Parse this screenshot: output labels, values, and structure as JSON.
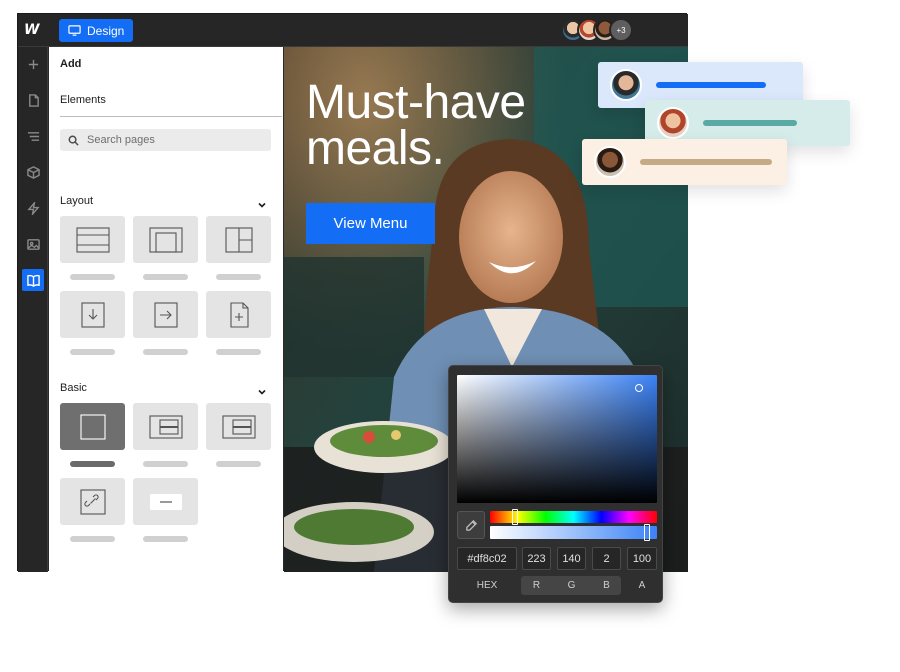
{
  "topbar": {
    "logo_text": "W",
    "design_button_label": "Design",
    "collaborators_extra": "+3"
  },
  "left_rail": {
    "icons": [
      "plus-icon",
      "page-icon",
      "navigator-icon",
      "components-icon",
      "interactions-icon",
      "assets-icon",
      "cms-book-icon"
    ],
    "active": "cms-book-icon"
  },
  "add_panel": {
    "title": "Add",
    "tab_label": "Elements",
    "search_placeholder": "Search pages",
    "sections": [
      {
        "label": "Layout"
      },
      {
        "label": "Basic"
      }
    ]
  },
  "canvas": {
    "headline_line1": "Must-have",
    "headline_line2": "meals.",
    "cta_label": "View Menu"
  },
  "color_picker": {
    "hex_value": "#df8c02",
    "r_value": "223",
    "g_value": "140",
    "b_value": "2",
    "a_value": "100",
    "hex_label": "HEX",
    "r_label": "R",
    "g_label": "G",
    "b_label": "B",
    "a_label": "A"
  },
  "colors": {
    "accent": "#146ef5",
    "card_blue": "#dbe8fb",
    "card_teal": "#d6eceb",
    "card_tan": "#fbf0e3"
  }
}
